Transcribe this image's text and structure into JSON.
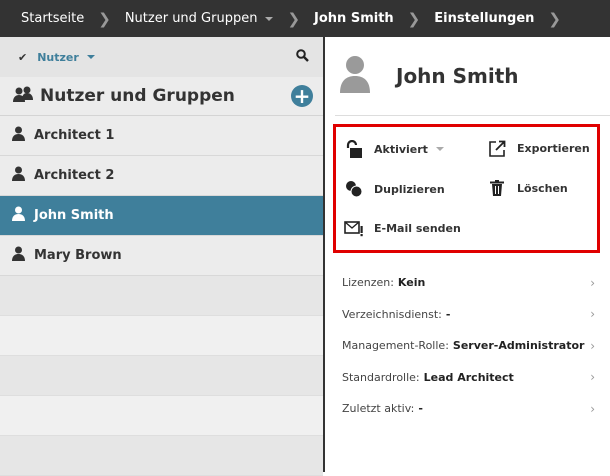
{
  "breadcrumb": [
    {
      "label": "Startseite"
    },
    {
      "label": "Nutzer und Gruppen"
    },
    {
      "label": "John Smith"
    },
    {
      "label": "Einstellungen"
    }
  ],
  "filter": {
    "label": "Nutzer"
  },
  "group_header": {
    "title": "Nutzer und Gruppen"
  },
  "users": [
    {
      "name": "Architect 1"
    },
    {
      "name": "Architect 2"
    },
    {
      "name": "John Smith",
      "selected": true
    },
    {
      "name": "Mary Brown"
    }
  ],
  "detail": {
    "name": "John Smith",
    "actions": {
      "activate": "Aktiviert",
      "export": "Exportieren",
      "duplicate": "Duplizieren",
      "delete": "Löschen",
      "email": "E-Mail senden"
    },
    "properties": [
      {
        "label": "Lizenzen:",
        "value": "Kein"
      },
      {
        "label": "Verzeichnisdienst:",
        "value": "-"
      },
      {
        "label": "Management-Rolle:",
        "value": "Server-Administrator"
      },
      {
        "label": "Standardrolle:",
        "value": "Lead Architect"
      },
      {
        "label": "Zuletzt aktiv:",
        "value": "-"
      }
    ]
  },
  "colors": {
    "accent": "#3f7f9b",
    "highlight": "#e00000",
    "topbar": "#333333"
  }
}
